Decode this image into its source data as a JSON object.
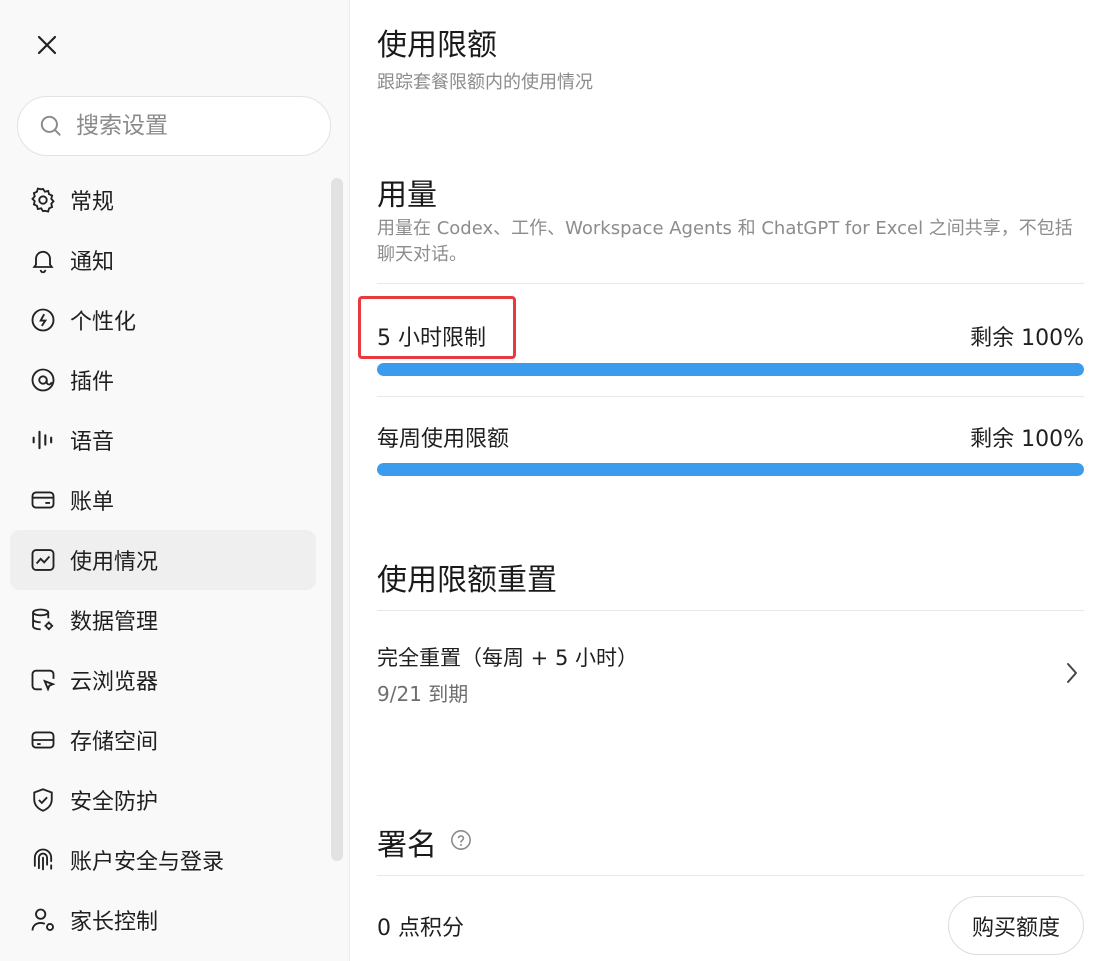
{
  "sidebar": {
    "search_placeholder": "搜索设置",
    "items": [
      {
        "label": "常规",
        "icon": "gear-icon"
      },
      {
        "label": "通知",
        "icon": "bell-icon"
      },
      {
        "label": "个性化",
        "icon": "personalization-icon"
      },
      {
        "label": "插件",
        "icon": "plugin-icon"
      },
      {
        "label": "语音",
        "icon": "voice-icon"
      },
      {
        "label": "账单",
        "icon": "wallet-icon"
      },
      {
        "label": "使用情况",
        "icon": "usage-chart-icon",
        "active": true
      },
      {
        "label": "数据管理",
        "icon": "database-settings-icon"
      },
      {
        "label": "云浏览器",
        "icon": "cloud-browser-icon"
      },
      {
        "label": "存储空间",
        "icon": "storage-icon"
      },
      {
        "label": "安全防护",
        "icon": "shield-icon"
      },
      {
        "label": "账户安全与登录",
        "icon": "fingerprint-icon"
      },
      {
        "label": "家长控制",
        "icon": "parental-control-icon"
      }
    ]
  },
  "main": {
    "title": "使用限额",
    "subtitle": "跟踪套餐限额内的使用情况",
    "usage": {
      "heading": "用量",
      "description": "用量在 Codex、工作、Workspace Agents 和 ChatGPT for Excel 之间共享，不包括聊天对话。",
      "limits": [
        {
          "label": "5 小时限制",
          "value": "剩余 100%",
          "remaining_fraction": 1.0
        },
        {
          "label": "每周使用限额",
          "value": "剩余 100%",
          "remaining_fraction": 1.0
        }
      ]
    },
    "reset": {
      "heading": "使用限额重置",
      "title": "完全重置（每周 + 5 小时）",
      "subtitle": "9/21 到期"
    },
    "attribution": {
      "heading": "署名",
      "credits": "0 点积分",
      "buy_label": "购买额度"
    }
  },
  "colors": {
    "accent": "#3b9bec",
    "highlight": "#e63a3f"
  }
}
